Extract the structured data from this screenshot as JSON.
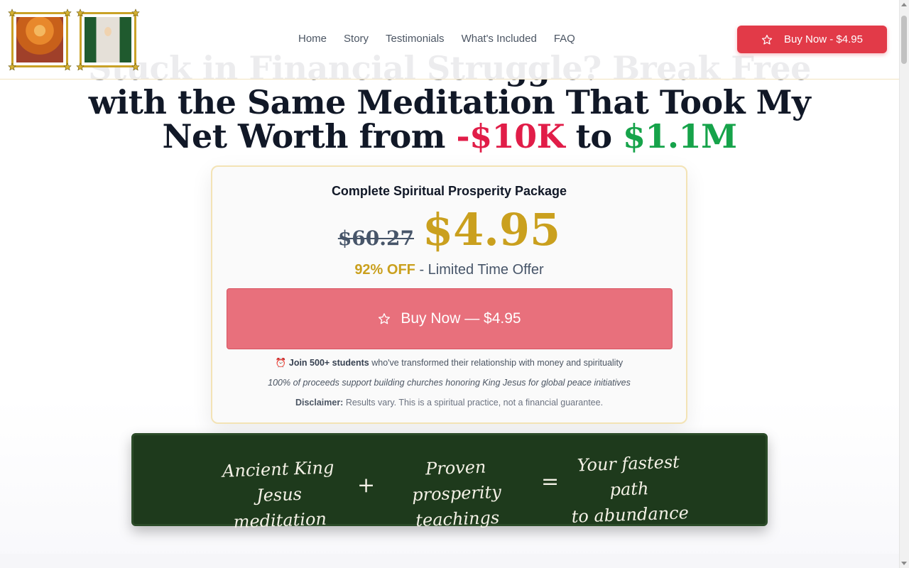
{
  "header": {
    "nav": [
      "Home",
      "Story",
      "Testimonials",
      "What's Included",
      "FAQ"
    ],
    "buy_button": "Buy Now - $4.95"
  },
  "hero": {
    "headline_line1": "Stuck in Financial Struggle? Break Free",
    "headline_line2": "with the Same Meditation That Took My",
    "headline_line3_prefix": "Net Worth from ",
    "headline_from": "-$10K",
    "headline_to_word": " to ",
    "headline_to": "$1.1M"
  },
  "card": {
    "title": "Complete Spiritual Prosperity Package",
    "old_price": "$60.27",
    "new_price": "$4.95",
    "discount": "92% OFF",
    "discount_suffix": " - Limited Time Offer",
    "button": "Buy Now — $4.95",
    "note_icon": "⏰",
    "note_bold": "Join 500+ students",
    "note_rest": " who've transformed their relationship with money and spirituality",
    "proceeds": "100% of proceeds support building churches honoring King Jesus for global peace initiatives",
    "disclaimer_label": "Disclaimer:",
    "disclaimer_text": " Results vary. This is a spiritual practice, not a financial guarantee."
  },
  "chalkboard": {
    "term1_line1": "Ancient King Jesus",
    "term1_line2": "meditation",
    "plus": "+",
    "term2_line1": "Proven",
    "term2_line2": "prosperity teachings",
    "equals": "=",
    "result_line1": "Your fastest path",
    "result_line2": "to abundance"
  },
  "colors": {
    "accent_red": "#e23a48",
    "gold": "#caa01e",
    "negative": "#e11d48",
    "positive": "#16a34a",
    "chalkboard": "#1e3a1c"
  },
  "icons": [
    "star-icon",
    "alarm-clock-icon"
  ]
}
